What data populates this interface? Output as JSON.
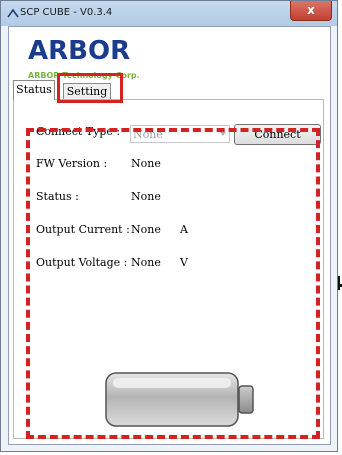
{
  "window": {
    "title": "SCP CUBE - V0.3.4",
    "close_label": "x"
  },
  "logo": {
    "main": "ARBOR",
    "sub": "ARBOR Technology Corp."
  },
  "tabs": [
    {
      "label": "Status"
    },
    {
      "label": "Setting"
    }
  ],
  "status_panel": {
    "connect_type_label": "Connect Type :",
    "connect_type_value": "None",
    "connect_button": "Connect",
    "fw_version_label": "FW Version :",
    "fw_version_value": "None",
    "status_label": "Status :",
    "status_value": "None",
    "output_current_label": "Output Current :",
    "output_current_value": "None",
    "output_current_unit": "A",
    "output_voltage_label": "Output Voltage :",
    "output_voltage_value": "None",
    "output_voltage_unit": "V"
  },
  "colors": {
    "highlight": "#d22222",
    "logo_blue": "#1a3c8c",
    "logo_green": "#7ab33a"
  },
  "icons": {
    "battery": "battery-icon",
    "app": "app-icon"
  }
}
